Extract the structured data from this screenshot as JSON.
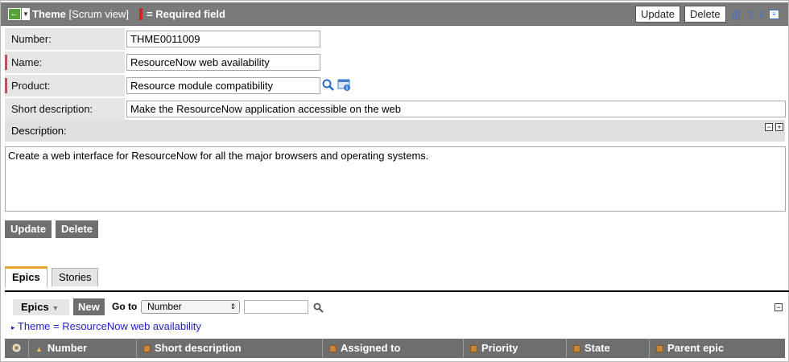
{
  "header": {
    "record_type": "Theme",
    "view": "[Scrum view]",
    "required_legend": "= Required field",
    "update_label": "Update",
    "delete_label": "Delete",
    "icons": [
      "back-arrow-icon",
      "attachment-icon",
      "arrow-up-icon",
      "arrow-down-icon",
      "list-icon"
    ]
  },
  "form": {
    "number": {
      "label": "Number:",
      "value": "THME0011009"
    },
    "name": {
      "label": "Name:",
      "value": "ResourceNow web availability"
    },
    "product": {
      "label": "Product:",
      "value": "Resource module compatibility"
    },
    "short_description": {
      "label": "Short description:",
      "value": "Make the ResourceNow application accessible on the web"
    },
    "description": {
      "label": "Description:",
      "value": "Create a web interface for ResourceNow for all the major browsers and operating systems."
    }
  },
  "actions": {
    "update_label": "Update",
    "delete_label": "Delete"
  },
  "tabs": [
    {
      "label": "Epics",
      "active": true
    },
    {
      "label": "Stories",
      "active": false
    }
  ],
  "list": {
    "dropdown_label": "Epics",
    "new_label": "New",
    "goto_label": "Go to",
    "goto_field": "Number",
    "search_value": "",
    "breadcrumb": "Theme = ResourceNow web availability",
    "columns": [
      "Number",
      "Short description",
      "Assigned to",
      "Priority",
      "State",
      "Parent epic"
    ]
  },
  "colors": {
    "header_bg": "#7a7a7a",
    "mandatory": "#b9545b",
    "required_marker": "#d02424",
    "tab_accent": "#f0a030",
    "link": "#2222cc"
  }
}
